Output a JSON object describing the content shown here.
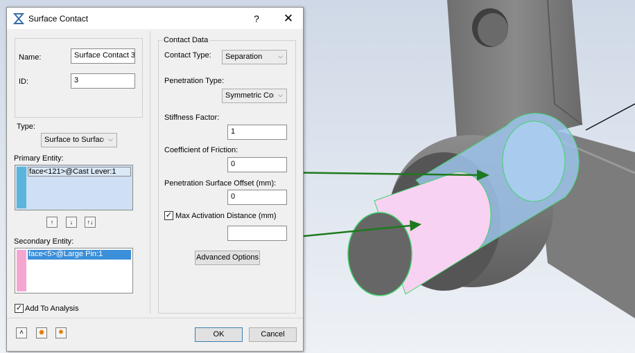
{
  "dialog": {
    "title": "Surface Contact",
    "help_label": "?",
    "close_label": "✕",
    "name_label": "Name:",
    "name_value": "Surface Contact 3",
    "id_label": "ID:",
    "id_value": "3",
    "type_label": "Type:",
    "type_value": "Surface to Surface",
    "primary_label": "Primary Entity:",
    "primary_item": "face<121>@Cast Lever:1",
    "secondary_label": "Secondary Entity:",
    "secondary_item": "face<5>@Large Pin:1",
    "move_up_icon": "↑",
    "move_down_icon": "↓",
    "swap_icon": "↑↓",
    "add_to_analysis_label": "Add To Analysis",
    "add_to_analysis_checked": true,
    "ok_label": "OK",
    "cancel_label": "Cancel"
  },
  "contact_data": {
    "group_label": "Contact Data",
    "contact_type_label": "Contact Type:",
    "contact_type_value": "Separation",
    "penetration_type_label": "Penetration Type:",
    "penetration_type_value": "Symmetric Cont",
    "stiffness_label": "Stiffness Factor:",
    "stiffness_value": "1",
    "friction_label": "Coefficient of Friction:",
    "friction_value": "0",
    "offset_label": "Penetration Surface Offset (mm):",
    "offset_value": "0",
    "max_activation_label": "Max Activation Distance (mm)",
    "max_activation_checked": true,
    "max_activation_value": "",
    "advanced_label": "Advanced Options"
  },
  "colors": {
    "primary_strip": "#5ab4dc",
    "secondary_strip": "#f4a6d0",
    "arrow": "#1d7a1d",
    "highlight_blue": "#9cc3ea",
    "highlight_pink": "#f8d2f2"
  }
}
